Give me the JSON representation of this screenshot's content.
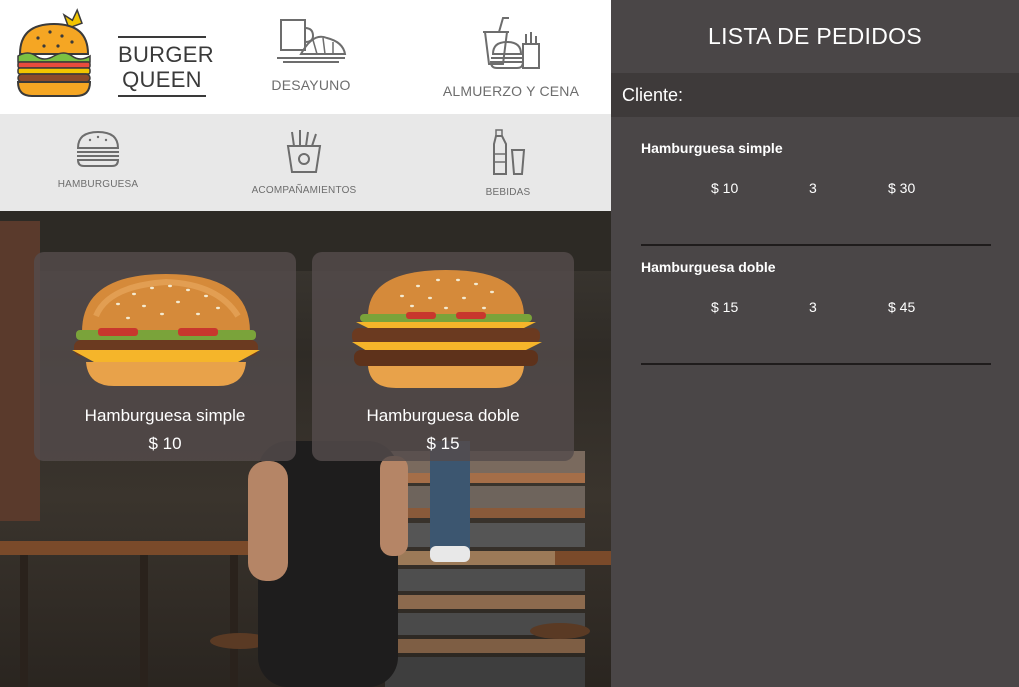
{
  "brand": {
    "line1": "BURGER",
    "line2": "QUEEN"
  },
  "top_nav": [
    {
      "label": "DESAYUNO",
      "icon": "breakfast-icon"
    },
    {
      "label": "ALMUERZO Y CENA",
      "icon": "lunch-dinner-icon"
    }
  ],
  "sub_nav": [
    {
      "label": "HAMBURGUESA",
      "icon": "burger-icon"
    },
    {
      "label": "ACOMPAÑAMIENTOS",
      "icon": "fries-icon"
    },
    {
      "label": "BEBIDAS",
      "icon": "drinks-icon"
    }
  ],
  "products": [
    {
      "name": "Hamburguesa simple",
      "price": "$ 10"
    },
    {
      "name": "Hamburguesa doble",
      "price": "$ 15"
    }
  ],
  "order_panel": {
    "title": "LISTA DE PEDIDOS",
    "client_label": "Cliente:",
    "items": [
      {
        "name": "Hamburguesa simple",
        "unit_price": "$ 10",
        "qty": "3",
        "total": "$ 30"
      },
      {
        "name": "Hamburguesa doble",
        "unit_price": "$ 15",
        "qty": "3",
        "total": "$ 45"
      }
    ]
  },
  "colors": {
    "panel_bg": "#4a4647",
    "client_bar": "#3e3a3a",
    "subnav_bg": "#e8e8e8",
    "card_bg": "#544c4c",
    "logo_bun": "#f5a623",
    "crown": "#f2c500"
  }
}
